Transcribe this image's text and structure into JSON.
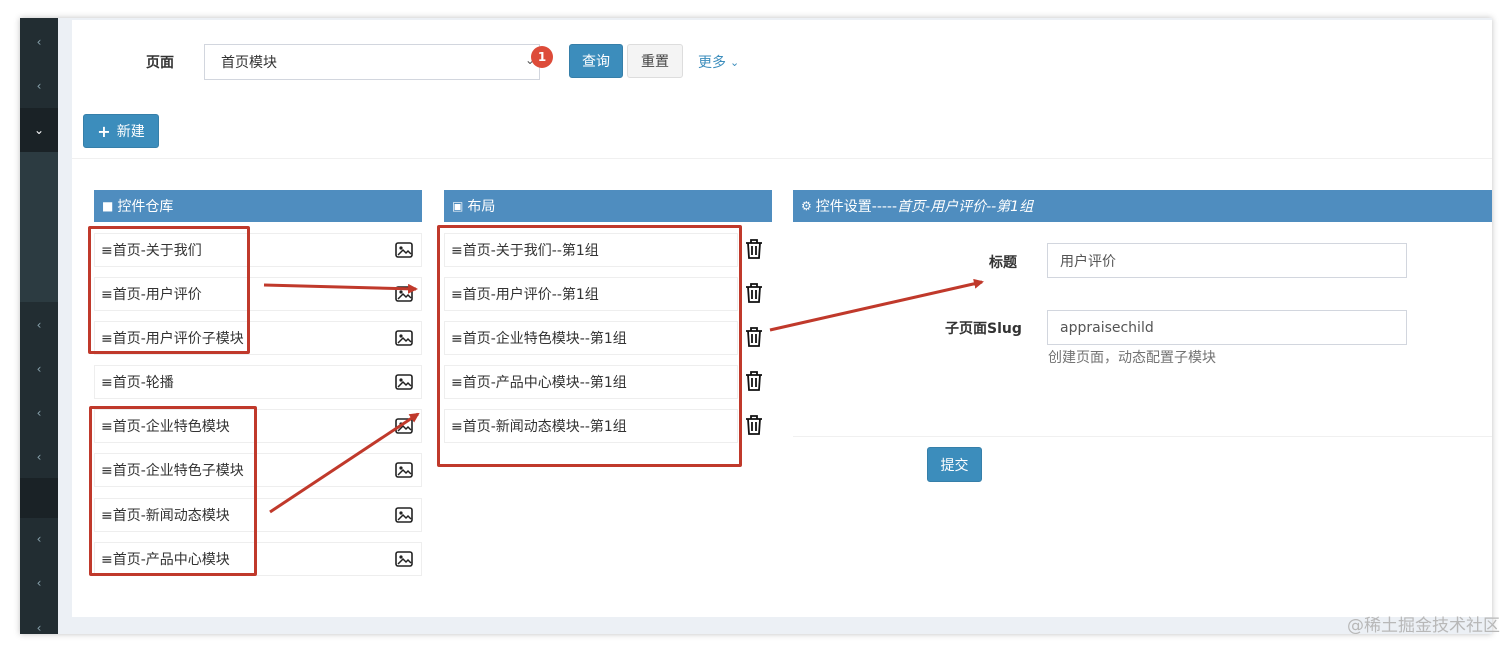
{
  "filter": {
    "page_label": "页面",
    "page_value": "首页模块",
    "badge": "1",
    "query_label": "查询",
    "reset_label": "重置",
    "more_label": "更多"
  },
  "toolbar": {
    "new_label": "新建"
  },
  "repo": {
    "title": "控件仓库",
    "items": [
      "≡首页-关于我们",
      "≡首页-用户评价",
      "≡首页-用户评价子模块",
      "≡首页-轮播",
      "≡首页-企业特色模块",
      "≡首页-企业特色子模块",
      "≡首页-新闻动态模块",
      "≡首页-产品中心模块"
    ]
  },
  "layout": {
    "title": "布局",
    "items": [
      "≡首页-关于我们--第1组",
      "≡首页-用户评价--第1组",
      "≡首页-企业特色模块--第1组",
      "≡首页-产品中心模块--第1组",
      "≡首页-新闻动态模块--第1组"
    ]
  },
  "settings": {
    "title_prefix": "控件设置-----",
    "title_em": "首页-用户评价--第1组",
    "field_title_label": "标题",
    "field_title_value": "用户评价",
    "field_slug_label": "子页面Slug",
    "field_slug_value": "appraisechild",
    "field_slug_help": "创建页面，动态配置子模块",
    "submit_label": "提交"
  },
  "watermark": "@稀土掘金技术社区",
  "colors": {
    "primary": "#3c8dbc",
    "panel_header": "#4f8dbf",
    "annotation": "#c0392b",
    "sidebar": "#222d32",
    "badge": "#dd4b39"
  },
  "icons": {
    "sidebar_collapsed": "chevron-left-icon",
    "sidebar_expanded": "chevron-down-icon",
    "item_preview": "image-icon",
    "item_delete": "trash-icon",
    "repo": "folder-icon",
    "layout": "archive-icon",
    "settings": "cogs-icon",
    "new": "plus-icon"
  }
}
